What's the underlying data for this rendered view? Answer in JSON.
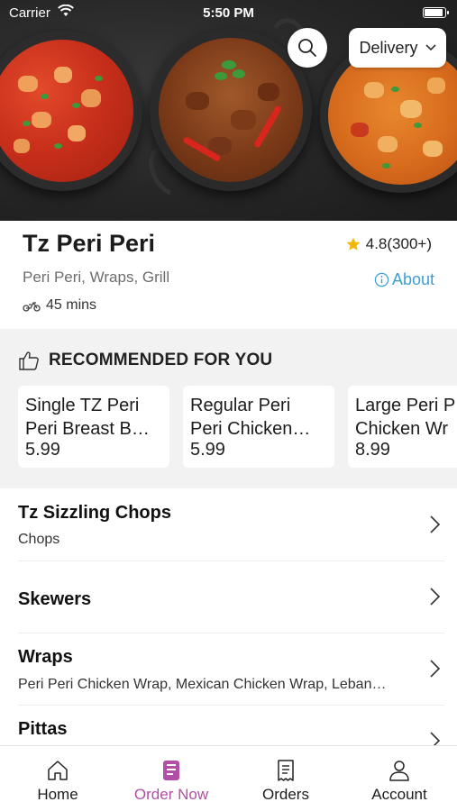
{
  "status_bar": {
    "carrier": "Carrier",
    "time": "5:50 PM"
  },
  "header": {
    "delivery_label": "Delivery"
  },
  "restaurant": {
    "name": "Tz Peri Peri",
    "rating": "4.8(300+)",
    "cuisines": "Peri Peri, Wraps, Grill",
    "about_label": "About",
    "eta": "45 mins"
  },
  "recommended": {
    "heading": "RECOMMENDED FOR YOU",
    "items": [
      {
        "line1": "Single TZ Peri",
        "line2": "Peri Breast B…",
        "price": "5.99"
      },
      {
        "line1": "Regular Peri",
        "line2": "Peri Chicken…",
        "price": "5.99"
      },
      {
        "line1": "Large Peri P",
        "line2": "Chicken Wr",
        "price": "8.99"
      }
    ]
  },
  "categories": [
    {
      "name": "Tz Sizzling Chops",
      "subtitle": "Chops"
    },
    {
      "name": "Skewers",
      "subtitle": ""
    },
    {
      "name": "Wraps",
      "subtitle": "Peri Peri Chicken Wrap, Mexican Chicken Wrap, Leban…"
    },
    {
      "name": "Pittas",
      "subtitle": ""
    }
  ],
  "tabs": [
    {
      "label": "Home",
      "icon": "home-icon"
    },
    {
      "label": "Order Now",
      "icon": "order-icon"
    },
    {
      "label": "Orders",
      "icon": "receipt-icon"
    },
    {
      "label": "Account",
      "icon": "person-icon"
    }
  ],
  "colors": {
    "accent": "#b24ea6",
    "link": "#3c9fd0",
    "star": "#f2b705"
  }
}
